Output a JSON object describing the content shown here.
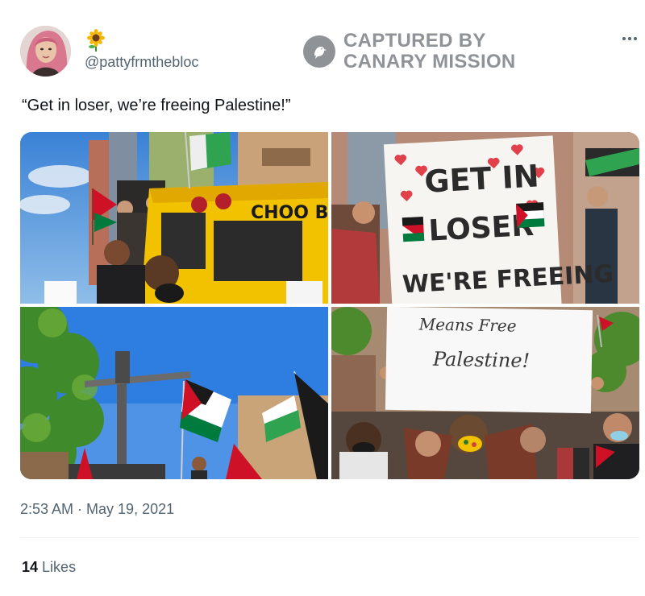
{
  "tweet": {
    "avatar_emoji": "🌻",
    "handle": "@pattyfrmthebloc",
    "text": "“Get in loser, we’re freeing Palestine!”",
    "timestamp": "2:53 AM · May 19, 2021",
    "likes_count": "14",
    "likes_label": "Likes"
  },
  "watermark": {
    "line1": "CAPTURED BY",
    "line2": "CANARY MISSION",
    "icon": "canary-bird-icon"
  },
  "photos": {
    "bus_sign": "CHOO BU",
    "sign1_lines": [
      "GET IN",
      "LOSER",
      "WE'RE FREEING"
    ],
    "sign2_lines": [
      "Means Free",
      "Palestine!"
    ]
  },
  "icons": {
    "more": "more-dots-icon"
  },
  "colors": {
    "text_primary": "#0f1419",
    "text_secondary": "#536471",
    "watermark_gray": "#8f9296",
    "palestine_red": "#ce1126",
    "palestine_green": "#007a3d",
    "bus_yellow": "#f2c200"
  }
}
